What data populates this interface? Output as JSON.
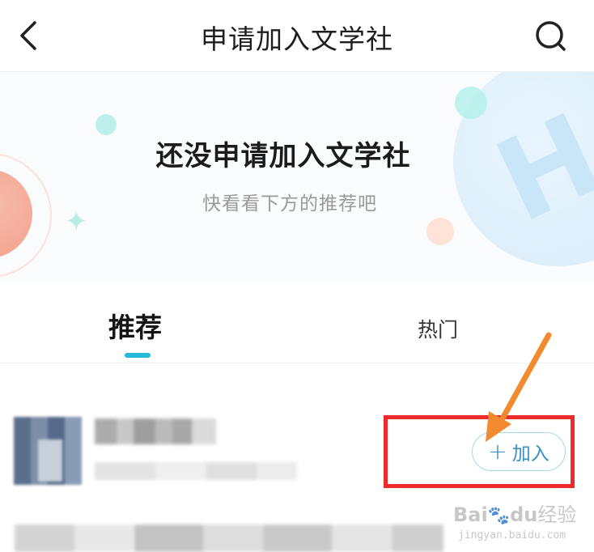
{
  "header": {
    "title": "申请加入文学社",
    "back_icon": "chevron-left-icon",
    "search_icon": "search-icon"
  },
  "banner": {
    "title": "还没申请加入文学社",
    "subtitle": "快看看下方的推荐吧"
  },
  "tabs": [
    {
      "label": "推荐",
      "active": true
    },
    {
      "label": "热门",
      "active": false
    }
  ],
  "list": {
    "items": [
      {
        "join_label": "加入"
      }
    ]
  },
  "watermark": {
    "brand_part1": "Bai",
    "brand_part2": "du",
    "brand_suffix": "经验",
    "url": "jingyan.baidu.com"
  },
  "colors": {
    "accent": "#27b9d9",
    "join_text": "#3a8fc0",
    "highlight": "#ee2b2b",
    "arrow": "#f28a2f"
  }
}
